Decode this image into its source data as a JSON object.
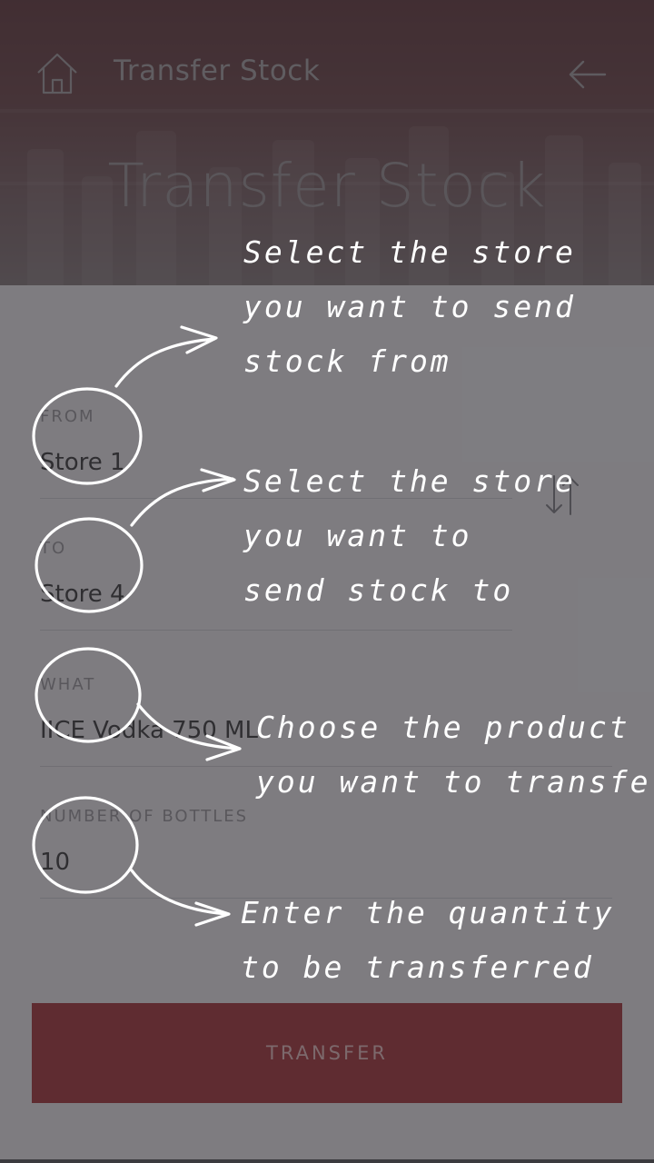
{
  "header": {
    "title": "Transfer Stock",
    "hero_title": "Transfer Stock",
    "home_icon": "home-icon",
    "back_icon": "arrow-left-icon"
  },
  "form": {
    "from": {
      "label": "FROM",
      "value": "Store 1"
    },
    "to": {
      "label": "TO",
      "value": "Store 4"
    },
    "what": {
      "label": "WHAT",
      "value": "IICE Vodka 750 ML"
    },
    "bottles": {
      "label": "NUMBER OF BOTTLES",
      "value": "10"
    },
    "swap_icon": "swap-vertical-icon"
  },
  "transfer_button": {
    "label": "TRANSFER"
  },
  "annotations": {
    "from": [
      "Select the store",
      "you want to send",
      "stock from"
    ],
    "to": [
      "Select the store",
      "you want to",
      "send stock to"
    ],
    "what": [
      "Choose the product",
      "you want to transfer"
    ],
    "bottles": [
      "Enter the quantity",
      "to be transferred"
    ]
  },
  "colors": {
    "accent": "#9b1a1e",
    "overlay": "#3a393e",
    "hero": "#4e1e22"
  }
}
